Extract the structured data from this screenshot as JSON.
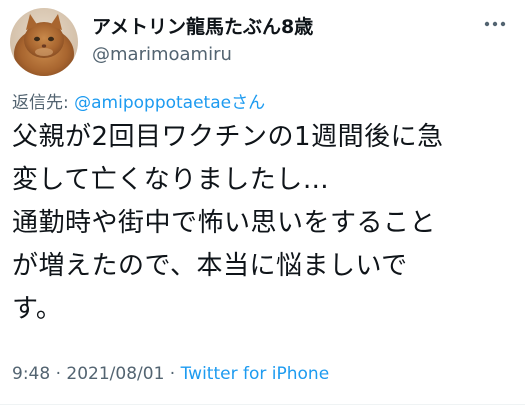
{
  "author": {
    "display_name": "アメトリン龍馬たぶん8歳",
    "handle": "@marimoamiru"
  },
  "reply": {
    "prefix": "返信先: ",
    "mention": "@amipoppotaetae",
    "suffix": "さん"
  },
  "tweet": {
    "lines": [
      "父親が2回目ワクチンの1週間後に急",
      "変して亡くなりましたし…",
      "通勤時や街中で怖い思いをすること",
      "が増えたので、本当に悩ましいで",
      "す。"
    ]
  },
  "meta": {
    "time": "9:48",
    "separator1": " · ",
    "date": "2021/08/01",
    "separator2": " · ",
    "source": "Twitter for iPhone"
  },
  "icons": {
    "more": "more-horizontal-icon",
    "avatar": "cat-avatar"
  },
  "colors": {
    "accent": "#1d9bf0",
    "secondary_text": "#536471",
    "primary_text": "#0f1419"
  }
}
